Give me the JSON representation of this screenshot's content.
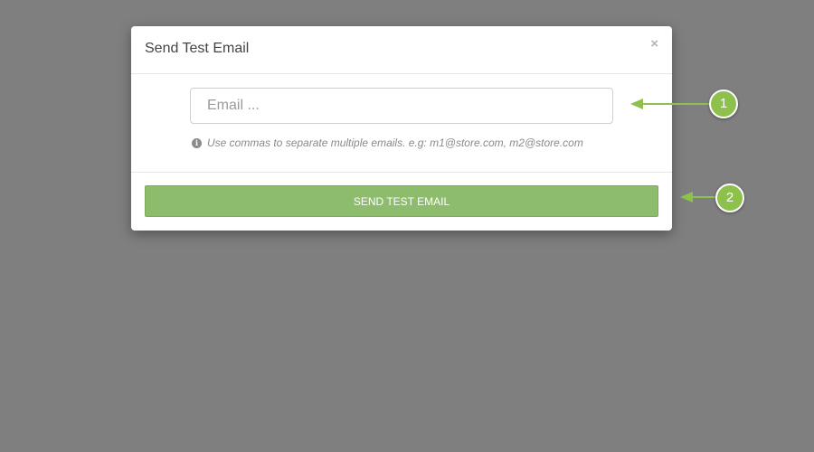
{
  "modal": {
    "title": "Send Test Email",
    "close_label": "×",
    "email_input": {
      "placeholder": "Email ...",
      "value": ""
    },
    "help_icon": "info-icon",
    "help_text": "Use commas to separate multiple emails. e.g: m1@store.com, m2@store.com",
    "send_button_label": "SEND TEST EMAIL"
  },
  "callouts": [
    {
      "number": "1"
    },
    {
      "number": "2"
    }
  ],
  "colors": {
    "overlay": "#7f7f7f",
    "button": "#8dbd6c",
    "callout": "#8dc04d"
  }
}
